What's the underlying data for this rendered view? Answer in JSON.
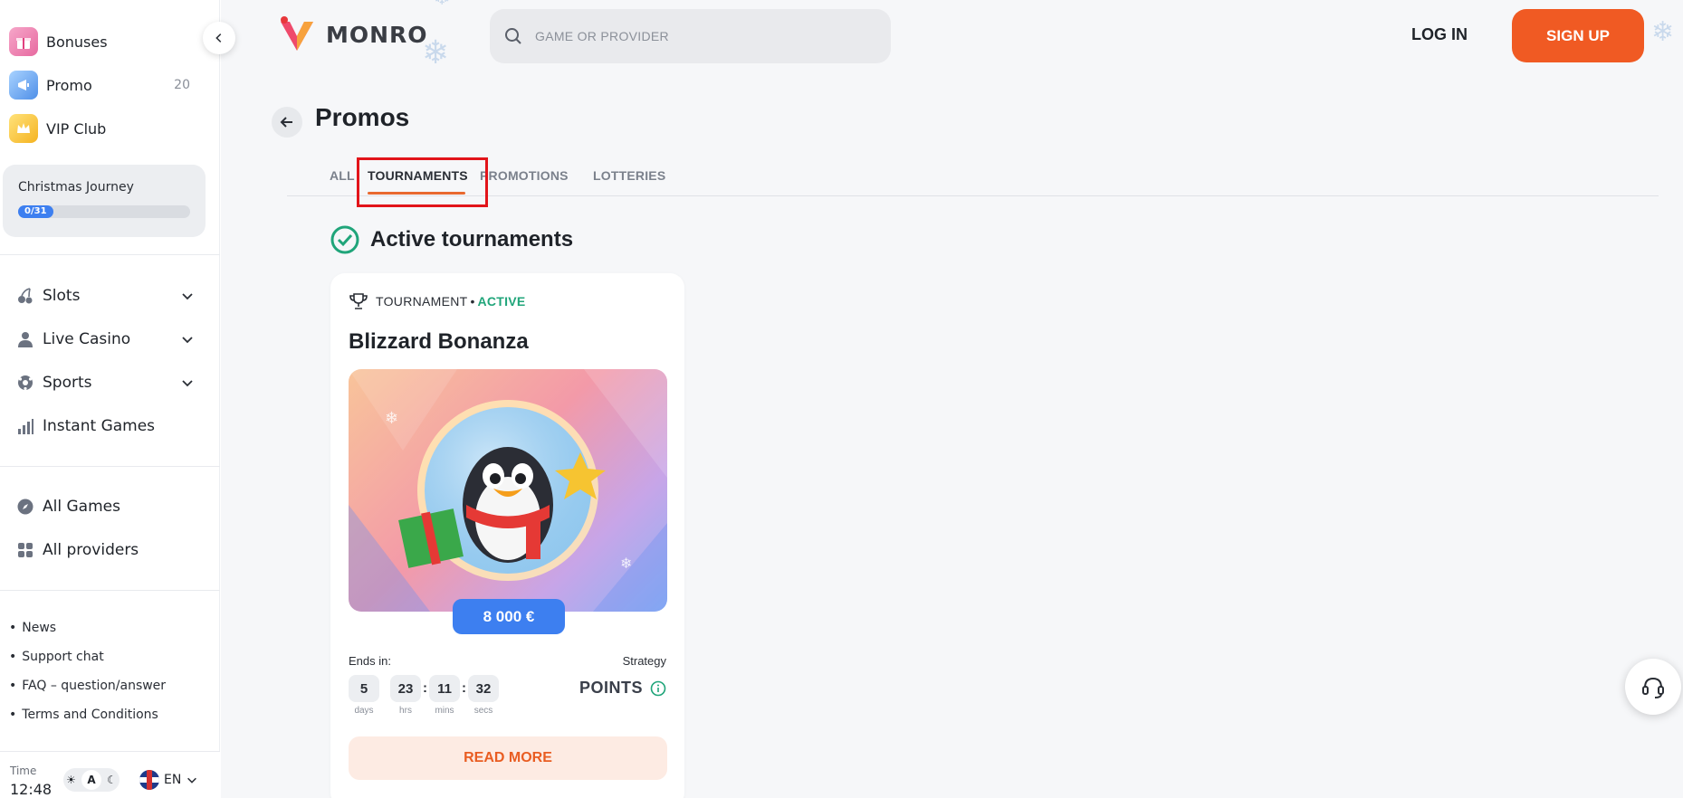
{
  "sidebar": {
    "top_links": [
      {
        "label": "Bonuses",
        "icon": "gift-icon"
      },
      {
        "label": "Promo",
        "icon": "megaphone-icon",
        "count": "20"
      },
      {
        "label": "VIP Club",
        "icon": "crown-icon"
      }
    ],
    "journey": {
      "title": "Christmas Journey",
      "progress": "0/31",
      "progress_fraction": 0
    },
    "nav": [
      {
        "label": "Slots",
        "icon": "cherry-icon",
        "expandable": true
      },
      {
        "label": "Live Casino",
        "icon": "dealer-icon",
        "expandable": true
      },
      {
        "label": "Sports",
        "icon": "ball-icon",
        "expandable": true
      },
      {
        "label": "Instant Games",
        "icon": "bar-chart-icon",
        "expandable": false
      }
    ],
    "nav2": [
      {
        "label": "All Games",
        "icon": "compass-icon"
      },
      {
        "label": "All providers",
        "icon": "grid-icon"
      }
    ],
    "links": [
      "News",
      "Support chat",
      "FAQ – question/answer",
      "Terms and Conditions"
    ],
    "footer": {
      "time_label": "Time",
      "time_value": "12:48",
      "theme_label": "A",
      "lang": "EN"
    }
  },
  "header": {
    "logo_text": "MONRO",
    "search_placeholder": "GAME OR PROVIDER",
    "login_label": "LOG IN",
    "signup_label": "SIGN UP"
  },
  "page": {
    "title": "Promos",
    "tabs": [
      {
        "label": "ALL",
        "active": false
      },
      {
        "label": "TOURNAMENTS",
        "active": true
      },
      {
        "label": "PROMOTIONS",
        "active": false
      },
      {
        "label": "LOTTERIES",
        "active": false
      }
    ],
    "section_title": "Active tournaments"
  },
  "card": {
    "type": "TOURNAMENT",
    "separator": "•",
    "status": "ACTIVE",
    "title": "Blizzard Bonanza",
    "prize": "8 000 €",
    "ends_label": "Ends in:",
    "strategy_label": "Strategy",
    "strategy_value": "POINTS",
    "timer": [
      {
        "value": "5",
        "unit": "days"
      },
      {
        "value": "23",
        "unit": "hrs"
      },
      {
        "value": "11",
        "unit": "mins"
      },
      {
        "value": "32",
        "unit": "secs"
      }
    ],
    "cta": "READ MORE"
  },
  "colors": {
    "accent": "#f05a23",
    "blue": "#3d7ff0",
    "active_green": "#20a57a",
    "highlight": "#e2141a"
  }
}
